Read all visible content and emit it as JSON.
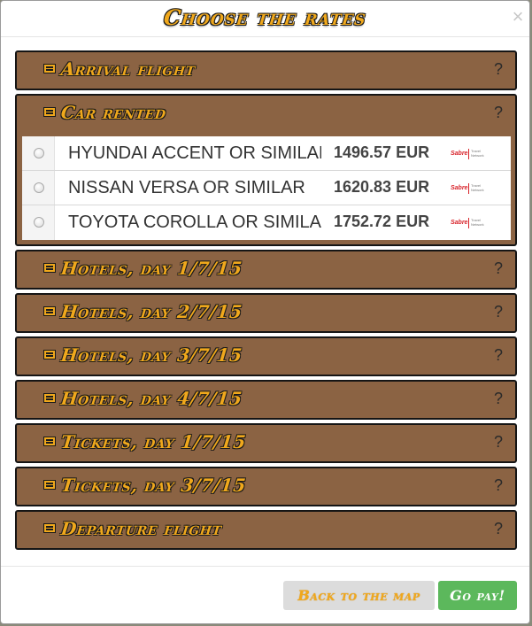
{
  "modal": {
    "title": "Choose the rates",
    "close_label": "×"
  },
  "panels": [
    {
      "title": "Arrival flight",
      "help": "?"
    },
    {
      "title": "Car rented",
      "help": "?"
    },
    {
      "title": "Hotels, day 1/7/15",
      "help": "?"
    },
    {
      "title": "Hotels, day 2/7/15",
      "help": "?"
    },
    {
      "title": "Hotels, day 3/7/15",
      "help": "?"
    },
    {
      "title": "Hotels, day 4/7/15",
      "help": "?"
    },
    {
      "title": "Tickets, day 1/7/15",
      "help": "?"
    },
    {
      "title": "Tickets, day 3/7/15",
      "help": "?"
    },
    {
      "title": "Departure flight",
      "help": "?"
    }
  ],
  "car_rates": [
    {
      "name": "HYUNDAI ACCENT OR SIMILAR",
      "price": "1496.57 EUR",
      "provider": "Sabre",
      "provider_tag": "Travel Network"
    },
    {
      "name": "NISSAN VERSA OR SIMILAR",
      "price": "1620.83 EUR",
      "provider": "Sabre",
      "provider_tag": "Travel Network"
    },
    {
      "name": "TOYOTA COROLLA OR SIMILAR",
      "price": "1752.72 EUR",
      "provider": "Sabre",
      "provider_tag": "Travel Network"
    }
  ],
  "footer": {
    "back_label": "Back to the map",
    "go_label": "Go pay!"
  },
  "colors": {
    "panel_bg": "#8b6343",
    "title_accent": "#f0a81c",
    "go_button": "#5cb85c",
    "back_button": "#dcdcdc"
  }
}
